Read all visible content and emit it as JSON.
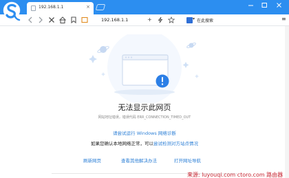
{
  "colors": {
    "accent": "#2c8ef0",
    "link": "#2c7fd6",
    "watermark": "#c6232f"
  },
  "tab": {
    "title": "192.168.1.1",
    "close": "×"
  },
  "nav": {
    "address": "192.168.1.1",
    "zoom": "+",
    "search_label": "在此搜索",
    "menu": "≡"
  },
  "icons": [
    "browser-logo-icon",
    "back-icon",
    "forward-icon",
    "stop-icon",
    "home-icon",
    "bookmark-icon",
    "tab-page-icon",
    "lightning-icon",
    "star-icon",
    "search-engine-icon",
    "menu-icon",
    "minimize-icon",
    "maximize-icon",
    "close-icon",
    "page-error-icon"
  ],
  "error": {
    "title": "无法显示此网页",
    "detail": "网站地址错误，错误代码 ERR_CONNECTION_TIMED_OUT",
    "diagnose_link": "请尝试运行 Windows 网络诊断",
    "check_prefix": "如果您确认本地网络正常，可以",
    "check_link": "尝试检测对方站点情况",
    "refresh": "刷新网页",
    "other_solutions": "查看其他解决办法",
    "open_navigation": "打开网址导航"
  },
  "watermark": "来源: luyouqi.com  ctoro.com 路由器"
}
